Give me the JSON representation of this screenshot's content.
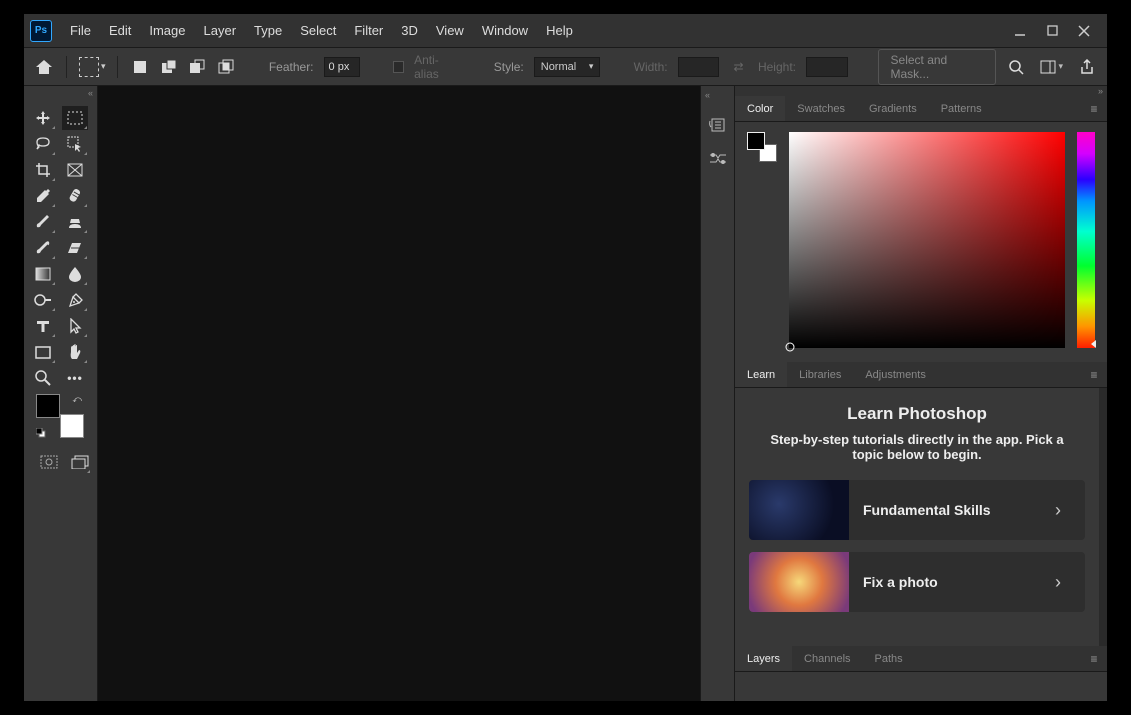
{
  "app_name": "Ps",
  "menu": [
    "File",
    "Edit",
    "Image",
    "Layer",
    "Type",
    "Select",
    "Filter",
    "3D",
    "View",
    "Window",
    "Help"
  ],
  "options_bar": {
    "feather_label": "Feather:",
    "feather_value": "0 px",
    "antialias_label": "Anti-alias",
    "style_label": "Style:",
    "style_value": "Normal",
    "width_label": "Width:",
    "height_label": "Height:",
    "select_mask_label": "Select and Mask..."
  },
  "color_panel": {
    "tabs": [
      "Color",
      "Swatches",
      "Gradients",
      "Patterns"
    ],
    "active": 0
  },
  "learn_panel": {
    "tabs": [
      "Learn",
      "Libraries",
      "Adjustments"
    ],
    "active": 0,
    "heading": "Learn Photoshop",
    "sub": "Step-by-step tutorials directly in the app. Pick a topic below to begin.",
    "cards": [
      {
        "title": "Fundamental Skills"
      },
      {
        "title": "Fix a photo"
      }
    ]
  },
  "layers_panel": {
    "tabs": [
      "Layers",
      "Channels",
      "Paths"
    ],
    "active": 0
  }
}
